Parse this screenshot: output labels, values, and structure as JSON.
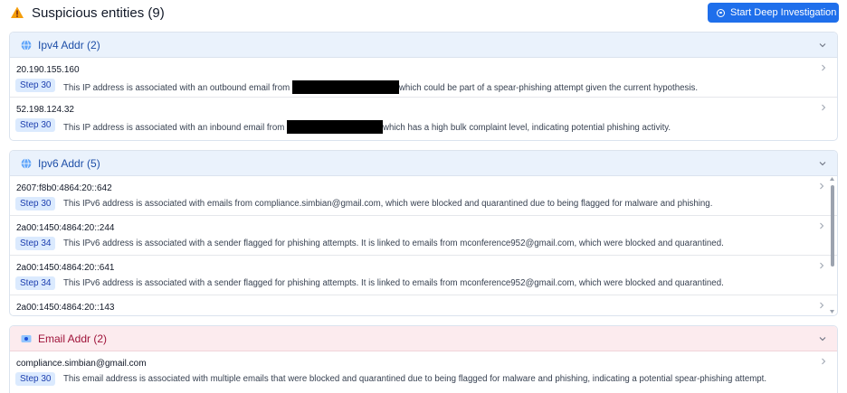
{
  "header": {
    "title": "Suspicious entities (9)",
    "button_label": "Start Deep Investigation"
  },
  "colors": {
    "accent": "#1f6feb",
    "warning": "#f59e0b",
    "step_bg": "#dbeafe",
    "step_text": "#1e40af"
  },
  "icons": {
    "warning": "warning-triangle-icon",
    "globe": "globe-icon",
    "email": "email-icon",
    "chevron": "chevron-down-icon"
  },
  "ipv4": {
    "title": "Ipv4 Addr (2)",
    "items": [
      {
        "value": "20.190.155.160",
        "step": "Step 30",
        "desc_before": "This IP address is associated with an outbound email from",
        "desc_after": "which could be part of a spear-phishing attempt given the current hypothesis."
      },
      {
        "value": "52.198.124.32",
        "step": "Step 30",
        "desc_before": "This IP address is associated with an inbound email from",
        "desc_after": "which has a high bulk complaint level, indicating potential phishing activity."
      }
    ]
  },
  "ipv6": {
    "title": "Ipv6 Addr (5)",
    "items": [
      {
        "value": "2607:f8b0:4864:20::642",
        "step": "Step 30",
        "desc": "This IPv6 address is associated with emails from compliance.simbian@gmail.com, which were blocked and quarantined due to being flagged for malware and phishing."
      },
      {
        "value": "2a00:1450:4864:20::244",
        "step": "Step 34",
        "desc": "This IPv6 address is associated with a sender flagged for phishing attempts. It is linked to emails from mconference952@gmail.com, which were blocked and quarantined."
      },
      {
        "value": "2a00:1450:4864:20::641",
        "step": "Step 34",
        "desc": "This IPv6 address is associated with a sender flagged for phishing attempts. It is linked to emails from mconference952@gmail.com, which were blocked and quarantined."
      },
      {
        "value": "2a00:1450:4864:20::143"
      }
    ]
  },
  "email": {
    "title": "Email Addr (2)",
    "items": [
      {
        "value": "compliance.simbian@gmail.com",
        "step": "Step 30",
        "desc": "This email address is associated with multiple emails that were blocked and quarantined due to being flagged for malware and phishing, indicating a potential spear-phishing attempt."
      }
    ]
  }
}
